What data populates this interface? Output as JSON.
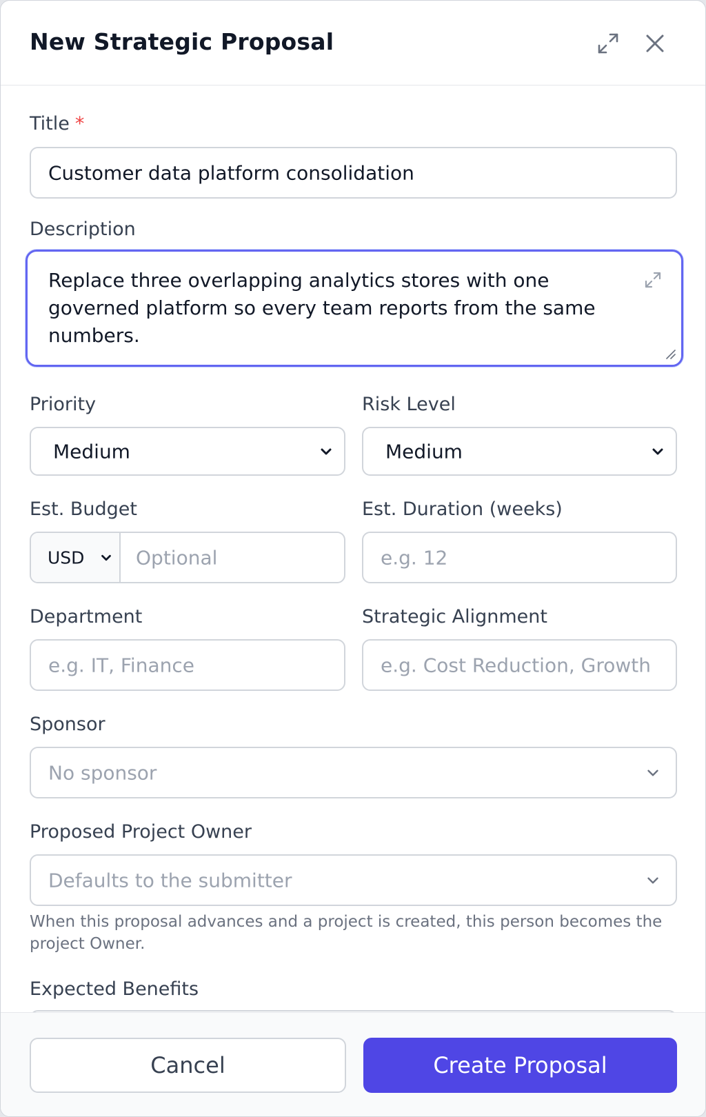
{
  "dialog": {
    "title": "New Strategic Proposal"
  },
  "form": {
    "title": {
      "label": "Title",
      "required_mark": "*",
      "value": "Customer data platform consolidation"
    },
    "description": {
      "label": "Description",
      "value": "Replace three overlapping analytics stores with one governed platform so every team reports from the same numbers."
    },
    "priority": {
      "label": "Priority",
      "value": "Medium"
    },
    "risk_level": {
      "label": "Risk Level",
      "value": "Medium"
    },
    "budget": {
      "label": "Est. Budget",
      "currency": "USD",
      "placeholder": "Optional"
    },
    "duration": {
      "label": "Est. Duration (weeks)",
      "placeholder": "e.g. 12"
    },
    "department": {
      "label": "Department",
      "placeholder": "e.g. IT, Finance"
    },
    "alignment": {
      "label": "Strategic Alignment",
      "placeholder": "e.g. Cost Reduction, Growth"
    },
    "sponsor": {
      "label": "Sponsor",
      "placeholder": "No sponsor"
    },
    "owner": {
      "label": "Proposed Project Owner",
      "placeholder": "Defaults to the submitter",
      "help": "When this proposal advances and a project is created, this person becomes the project Owner."
    },
    "benefits": {
      "label": "Expected Benefits"
    }
  },
  "footer": {
    "cancel_label": "Cancel",
    "create_label": "Create Proposal"
  },
  "colors": {
    "accent": "#4f46e5",
    "focus_ring": "#6366f1",
    "required": "#ef4444"
  },
  "icons": {
    "expand": "expand-icon",
    "close": "close-icon",
    "chevron": "chevron-down-icon"
  }
}
